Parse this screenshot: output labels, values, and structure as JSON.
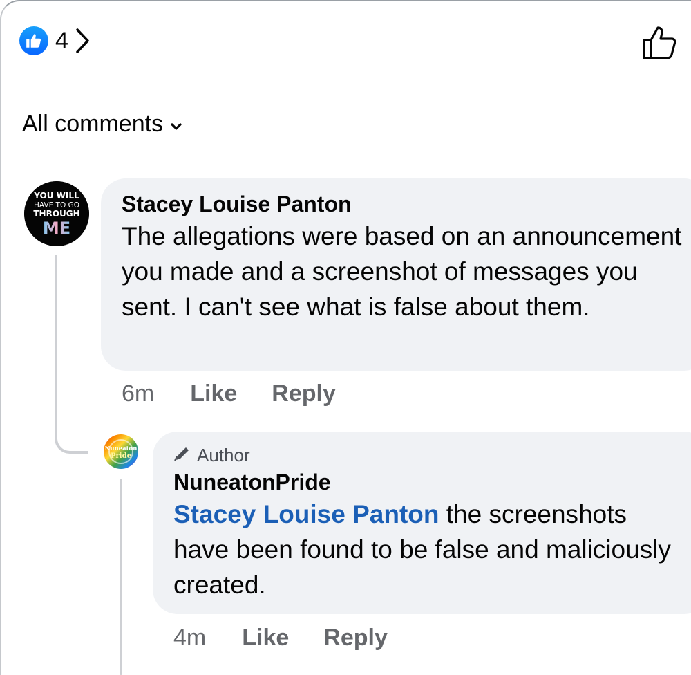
{
  "reactions": {
    "count": "4",
    "icon": "like-reaction-icon"
  },
  "filter": {
    "label": "All comments"
  },
  "comments": [
    {
      "author": "Stacey Louise Panton",
      "avatar_text": [
        "YOU WILL",
        "HAVE TO GO",
        "THROUGH",
        "ME"
      ],
      "text": "The allegations were based on an announcement you made and a screenshot of messages you sent. I can't see what is false about them.",
      "time": "6m",
      "like_label": "Like",
      "reply_label": "Reply"
    },
    {
      "badge": "Author",
      "author": "NuneatonPride",
      "avatar_text": [
        "Nuneaton",
        "Pride"
      ],
      "mention": "Stacey Louise Panton",
      "text": " the screenshots have been found to be false and maliciously created.",
      "time": "4m",
      "like_label": "Like",
      "reply_label": "Reply"
    }
  ],
  "colors": {
    "bubble": "#f0f2f5",
    "mention": "#1b5fb6",
    "secondary_text": "#65676b",
    "like_blue": "#0866ff"
  }
}
